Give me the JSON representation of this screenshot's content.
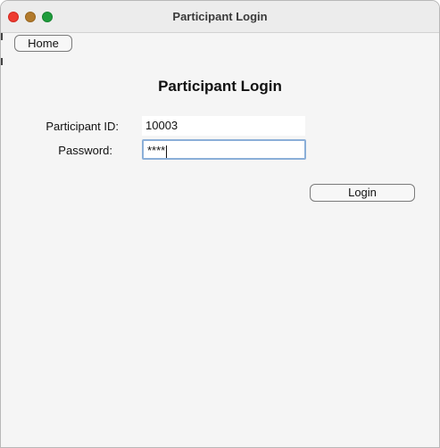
{
  "window": {
    "title": "Participant Login"
  },
  "toolbar": {
    "home_label": "Home"
  },
  "form": {
    "heading": "Participant Login",
    "participant_id_label": "Participant ID:",
    "participant_id_value": "10003",
    "password_label": "Password:",
    "password_value": "****",
    "login_label": "Login"
  },
  "colors": {
    "close": "#ee3b30",
    "minimize": "#b27a2c",
    "zoom": "#1f9c3c",
    "focus_ring": "#8bafd8",
    "background": "#f5f5f5"
  },
  "icons": [
    "close-icon",
    "minimize-icon",
    "zoom-icon"
  ]
}
